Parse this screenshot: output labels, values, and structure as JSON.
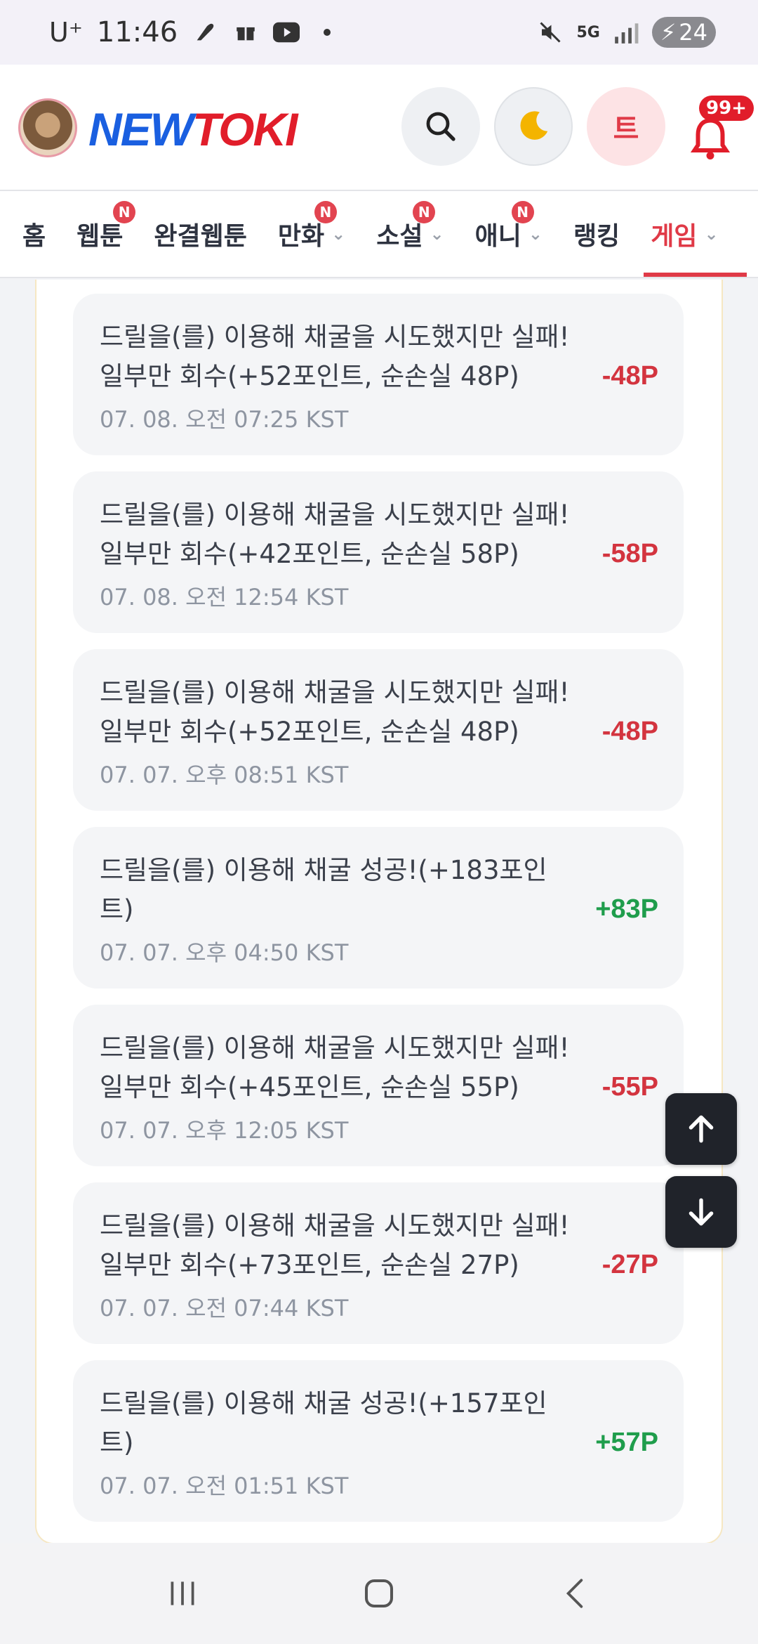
{
  "status_bar": {
    "carrier": "U⁺",
    "time": "11:46",
    "battery": "24",
    "network": "5G"
  },
  "header": {
    "logo_new": "NEW",
    "logo_toki": "TOKI",
    "user_initial": "트",
    "notification_count": "99+"
  },
  "nav": {
    "items": [
      {
        "label": "홈",
        "badge": "",
        "dropdown": false
      },
      {
        "label": "웹툰",
        "badge": "N",
        "dropdown": false
      },
      {
        "label": "완결웹툰",
        "badge": "",
        "dropdown": false
      },
      {
        "label": "만화",
        "badge": "N",
        "dropdown": true
      },
      {
        "label": "소설",
        "badge": "N",
        "dropdown": true
      },
      {
        "label": "애니",
        "badge": "N",
        "dropdown": true
      },
      {
        "label": "랭킹",
        "badge": "",
        "dropdown": false
      },
      {
        "label": "게임",
        "badge": "",
        "dropdown": true
      }
    ],
    "active": "게임"
  },
  "logs": [
    {
      "text": "드릴을(를) 이용해 채굴을 시도했지만 실패! 일부만 회수(+52포인트, 순손실 48P)",
      "time": "07. 08. 오전 07:25 KST",
      "amount": "-48P",
      "type": "neg"
    },
    {
      "text": "드릴을(를) 이용해 채굴을 시도했지만 실패! 일부만 회수(+42포인트, 순손실 58P)",
      "time": "07. 08. 오전 12:54 KST",
      "amount": "-58P",
      "type": "neg"
    },
    {
      "text": "드릴을(를) 이용해 채굴을 시도했지만 실패! 일부만 회수(+52포인트, 순손실 48P)",
      "time": "07. 07. 오후 08:51 KST",
      "amount": "-48P",
      "type": "neg"
    },
    {
      "text": "드릴을(를) 이용해 채굴 성공!(+183포인트)",
      "time": "07. 07. 오후 04:50 KST",
      "amount": "+83P",
      "type": "pos"
    },
    {
      "text": "드릴을(를) 이용해 채굴을 시도했지만 실패! 일부만 회수(+45포인트, 순손실 55P)",
      "time": "07. 07. 오후 12:05 KST",
      "amount": "-55P",
      "type": "neg"
    },
    {
      "text": "드릴을(를) 이용해 채굴을 시도했지만 실패! 일부만 회수(+73포인트, 순손실 27P)",
      "time": "07. 07. 오전 07:44 KST",
      "amount": "-27P",
      "type": "neg"
    },
    {
      "text": "드릴을(를) 이용해 채굴 성공!(+157포인트)",
      "time": "07. 07. 오전 01:51 KST",
      "amount": "+57P",
      "type": "pos"
    }
  ],
  "colors": {
    "brand_blue": "#1a5fe0",
    "brand_red": "#e11d2a",
    "negative": "#d3343f",
    "positive": "#1f9d4c"
  }
}
